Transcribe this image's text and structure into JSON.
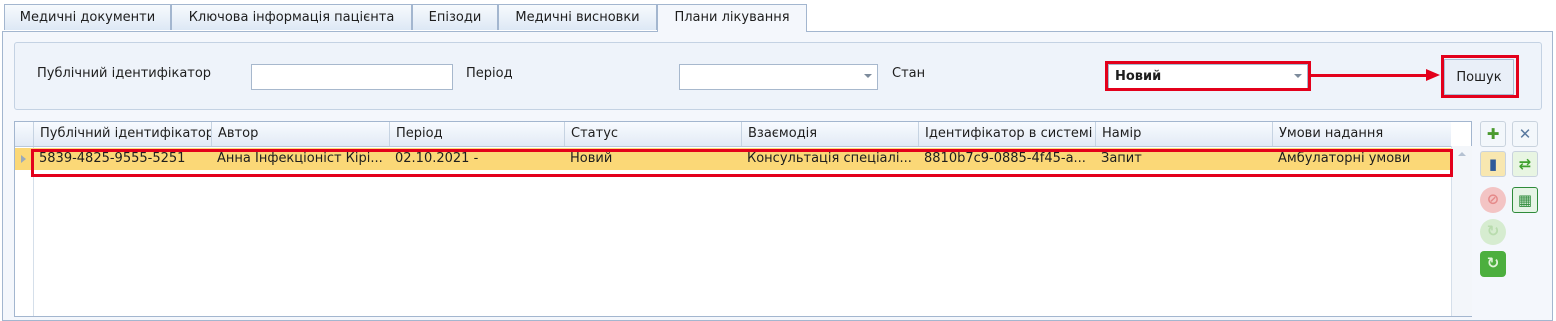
{
  "tabs": [
    {
      "label": "Медичні документи"
    },
    {
      "label": "Ключова інформація пацієнта"
    },
    {
      "label": "Епізоди"
    },
    {
      "label": "Медичні висновки"
    },
    {
      "label": "Плани лікування"
    }
  ],
  "filter": {
    "public_id_label": "Публічний ідентифікатор",
    "public_id_value": "",
    "period_label": "Період",
    "period_value": "",
    "state_label": "Стан",
    "state_value": "Новий",
    "search_button": "Пошук"
  },
  "table": {
    "columns": [
      "Публічний ідентифікатор",
      "Автор",
      "Період",
      "Статус",
      "Взаємодія",
      "Ідентифікатор в системі",
      "Намір",
      "Умови надання"
    ],
    "rows": [
      {
        "public_id": "5839-4825-9555-5251",
        "author": "Анна Інфекціоніст Кірі...",
        "period": "02.10.2021 -",
        "status": "Новий",
        "interaction": "Консультація спеціалі...",
        "system_id": "8810b7c9-0885-4f45-а...",
        "intent": "Запит",
        "conditions": "Амбулаторні умови"
      }
    ]
  },
  "toolbar_icons": [
    {
      "name": "new-document-icon",
      "color": "#4a9a2e"
    },
    {
      "name": "tools-icon",
      "color": "#5a7aa0"
    },
    {
      "name": "books-icon",
      "color": "#d9a323"
    },
    {
      "name": "refresh-arrows-icon",
      "color": "#3fa12d"
    },
    {
      "name": "cancel-icon",
      "color": "#e58a8a"
    },
    {
      "name": "spreadsheet-icon",
      "color": "#2e8b3a"
    },
    {
      "name": "round-refresh-disabled-icon",
      "color": "#b9dcae"
    },
    {
      "name": "round-refresh-icon",
      "color": "#4caf3e"
    }
  ],
  "colors": {
    "selected_row": "#fbd877",
    "highlight": "#e3001b"
  }
}
